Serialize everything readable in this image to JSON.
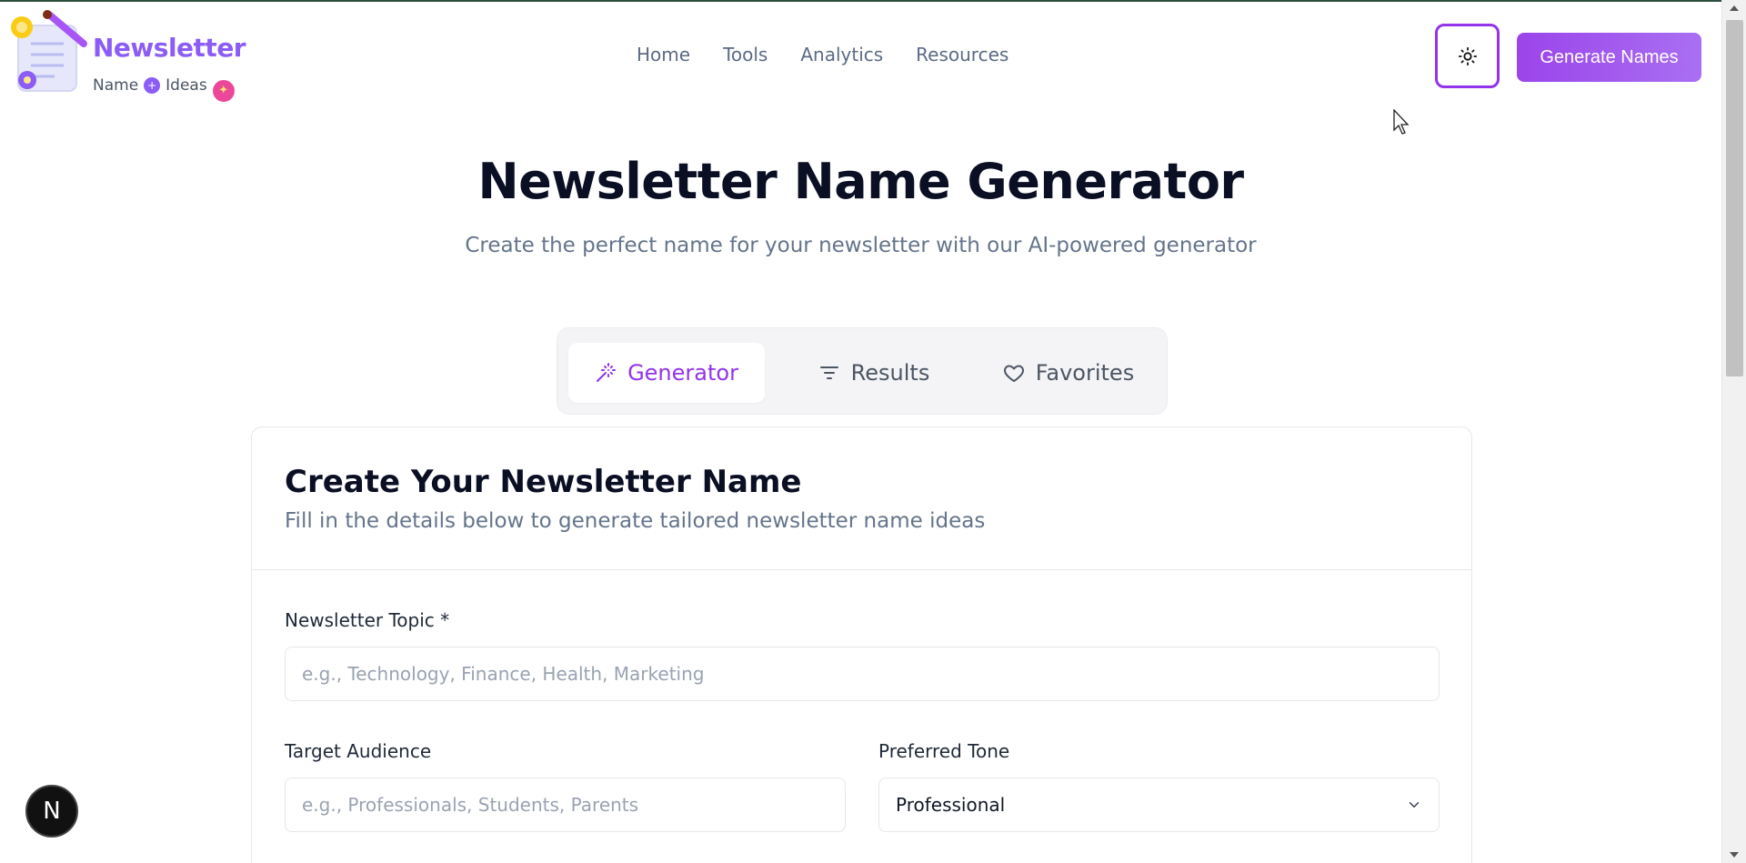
{
  "brand": {
    "title": "Newsletter",
    "sub_left": "Name",
    "sub_right": "Ideas"
  },
  "nav": {
    "items": [
      "Home",
      "Tools",
      "Analytics",
      "Resources"
    ]
  },
  "header": {
    "theme_icon": "sun-icon",
    "cta_label": "Generate Names"
  },
  "hero": {
    "title": "Newsletter Name Generator",
    "subtitle": "Create the perfect name for your newsletter with our AI-powered generator"
  },
  "tabs": [
    {
      "label": "Generator",
      "icon": "magic-wand-icon",
      "active": true
    },
    {
      "label": "Results",
      "icon": "filter-icon",
      "active": false
    },
    {
      "label": "Favorites",
      "icon": "heart-icon",
      "active": false
    }
  ],
  "form": {
    "title": "Create Your Newsletter Name",
    "description": "Fill in the details below to generate tailored newsletter name ideas",
    "topic": {
      "label": "Newsletter Topic *",
      "placeholder": "e.g., Technology, Finance, Health, Marketing"
    },
    "audience": {
      "label": "Target Audience",
      "placeholder": "e.g., Professionals, Students, Parents"
    },
    "tone": {
      "label": "Preferred Tone",
      "value": "Professional"
    }
  },
  "colors": {
    "accent": "#9333ea",
    "brand": "#8b5cf6",
    "muted_text": "#64748b"
  },
  "badge": {
    "letter": "N"
  }
}
